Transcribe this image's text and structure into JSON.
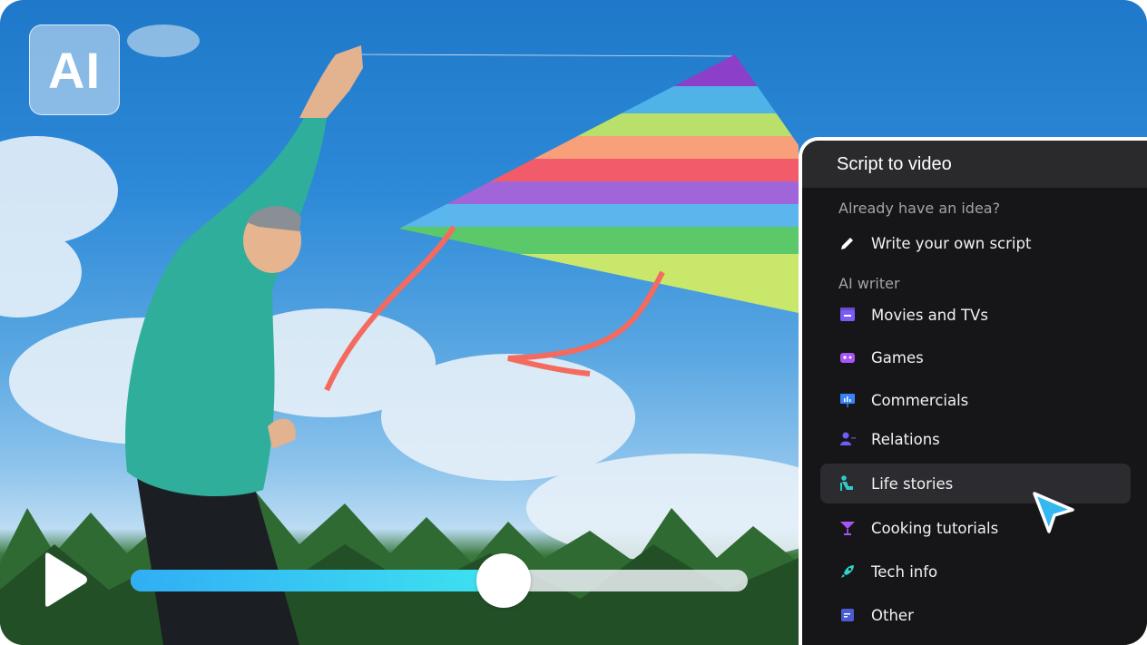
{
  "badge": {
    "label": "AI"
  },
  "player": {
    "progress": 0.605
  },
  "panel": {
    "title": "Script to video",
    "section_own": "Already have an idea?",
    "write_own": "Write your own script",
    "section_ai": "AI writer",
    "items": [
      {
        "label": "Movies and TVs",
        "icon": "clapperboard-icon",
        "color": "#7b5cf6"
      },
      {
        "label": "Games",
        "icon": "gamepad-icon",
        "color": "#a855f7"
      },
      {
        "label": "Commercials",
        "icon": "presentation-chart-icon",
        "color": "#3b82f6"
      },
      {
        "label": "Relations",
        "icon": "people-icon",
        "color": "#6d5ef6"
      },
      {
        "label": "Life stories",
        "icon": "person-sitting-icon",
        "color": "#2fc9c9"
      },
      {
        "label": "Cooking tutorials",
        "icon": "cocktail-glass-icon",
        "color": "#a855f7"
      },
      {
        "label": "Tech info",
        "icon": "rocket-icon",
        "color": "#2fd3c8"
      },
      {
        "label": "Other",
        "icon": "document-lines-icon",
        "color": "#4b5bd6"
      }
    ],
    "active_item": "Life stories"
  }
}
